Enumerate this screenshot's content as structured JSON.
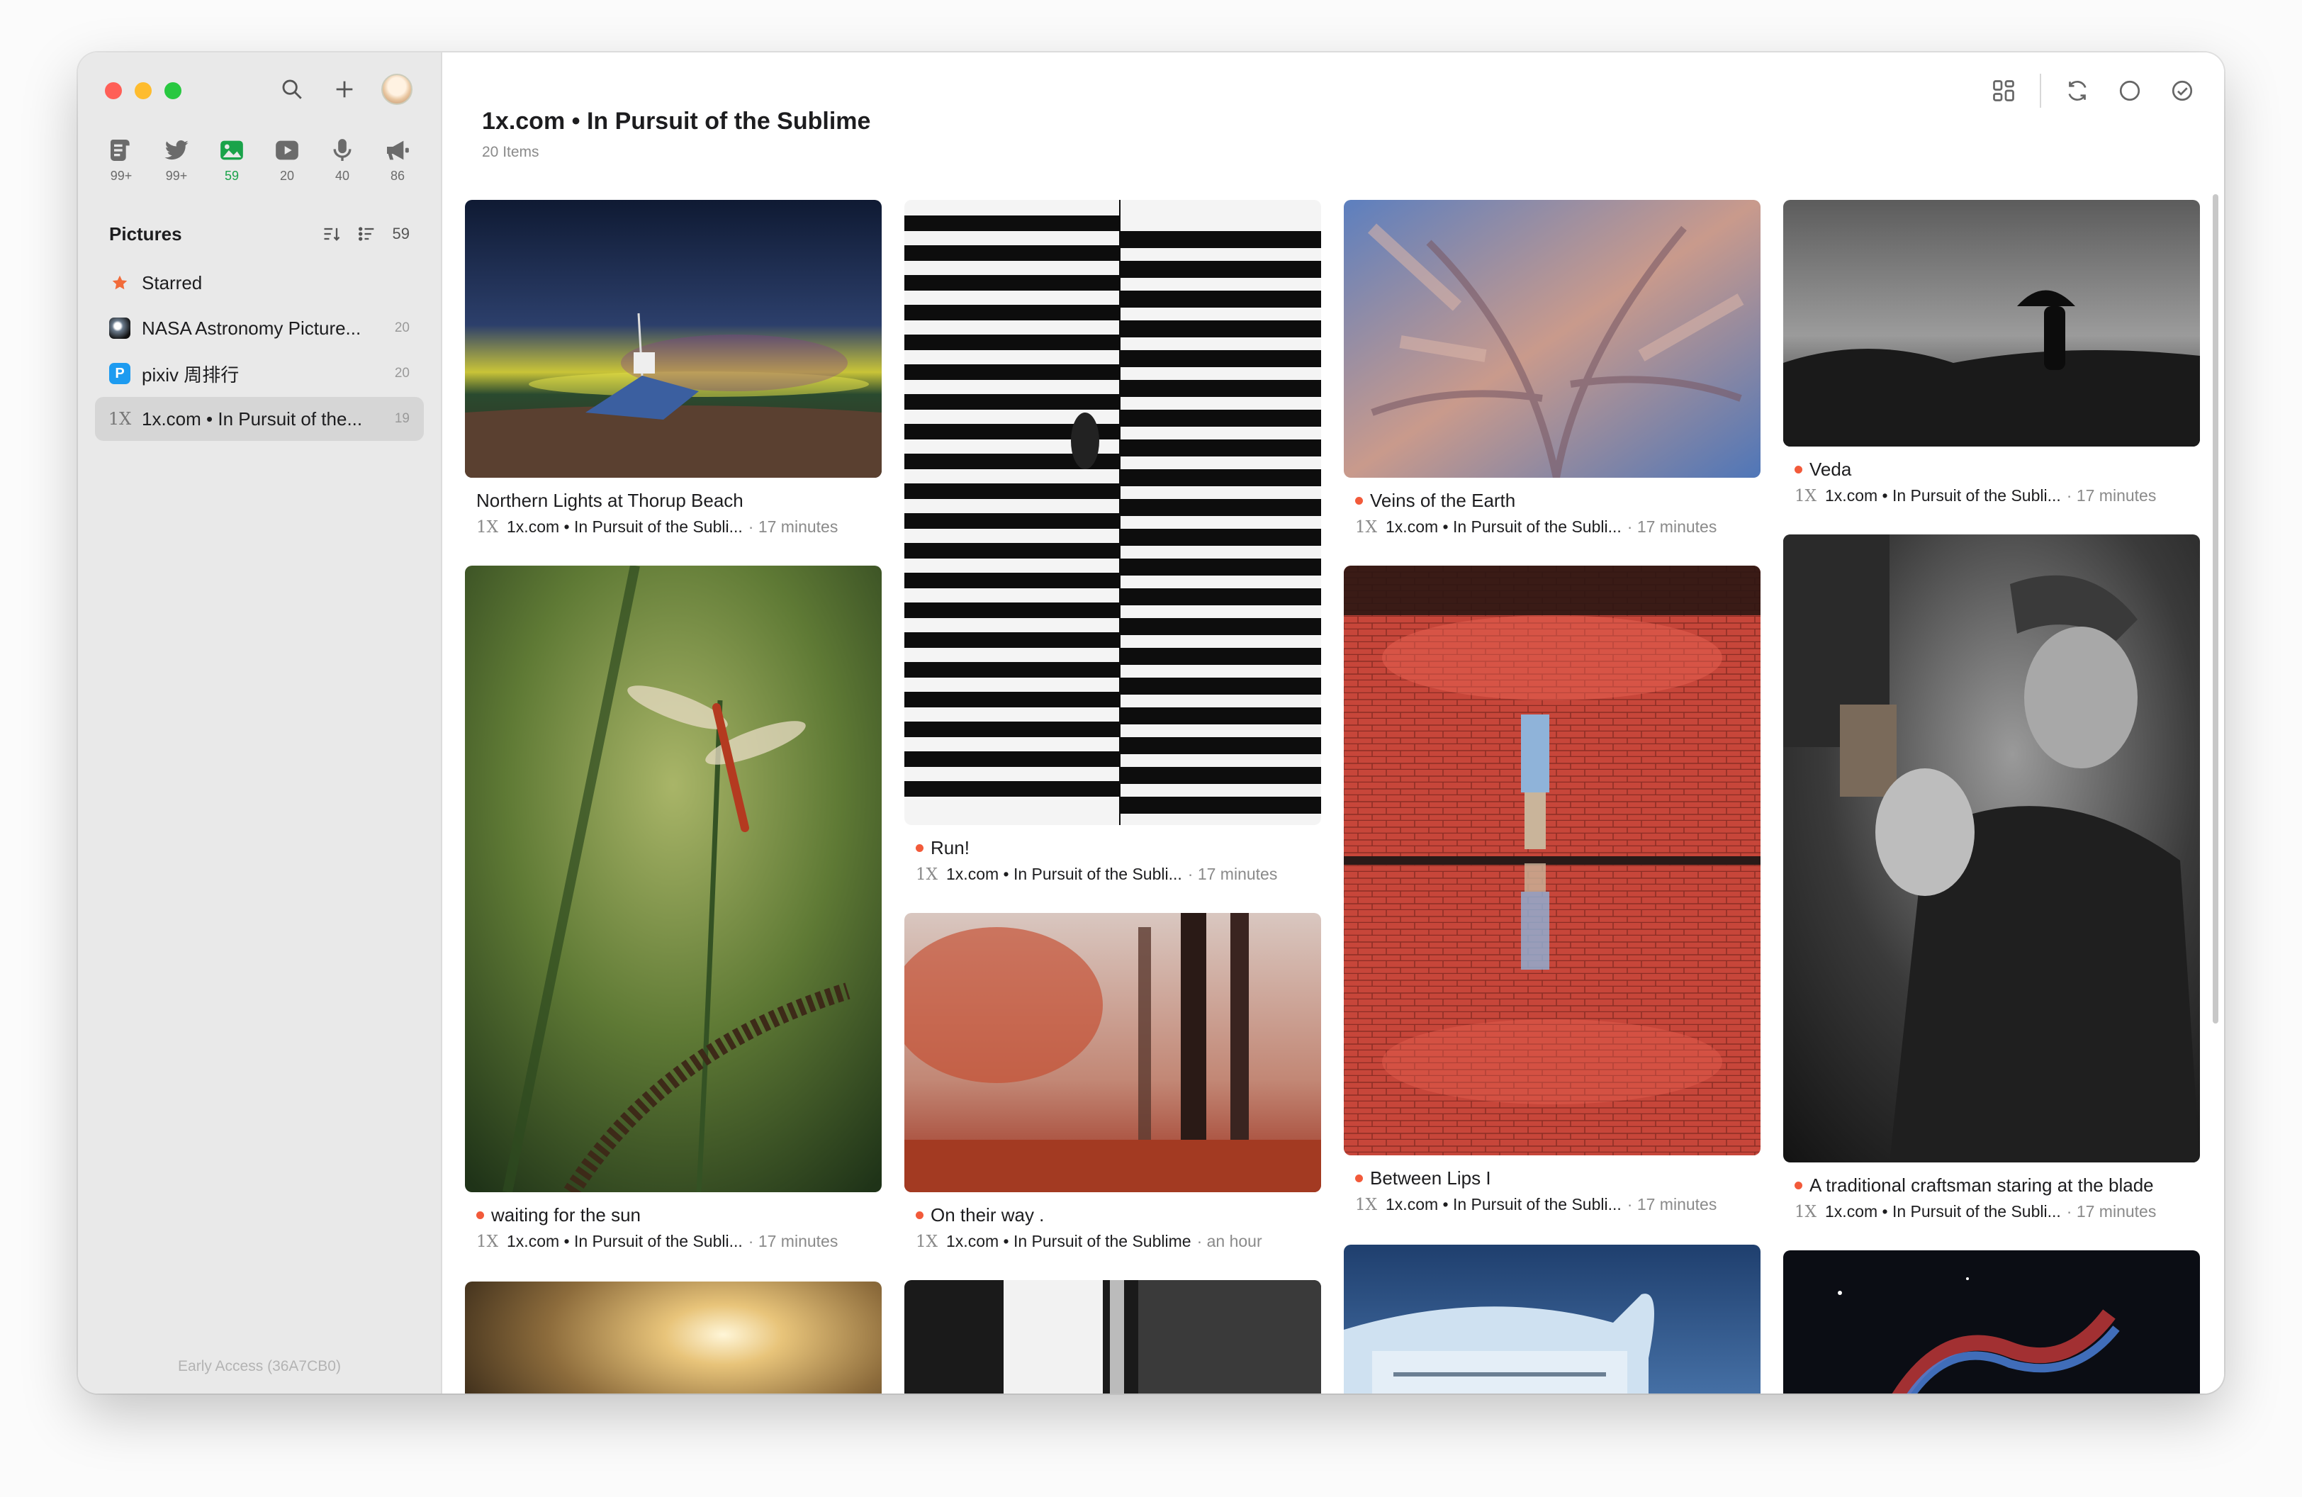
{
  "sidebar": {
    "type_tabs": [
      {
        "icon": "article-icon",
        "count": "99+"
      },
      {
        "icon": "twitter-icon",
        "count": "99+"
      },
      {
        "icon": "pictures-icon",
        "count": "59"
      },
      {
        "icon": "video-icon",
        "count": "20"
      },
      {
        "icon": "podcast-icon",
        "count": "40"
      },
      {
        "icon": "notification-icon",
        "count": "86"
      }
    ],
    "section_title": "Pictures",
    "section_count": "59",
    "feeds": [
      {
        "label": "Starred",
        "count": ""
      },
      {
        "label": "NASA Astronomy Picture...",
        "count": "20"
      },
      {
        "label": "pixiv 周排行",
        "count": "20"
      },
      {
        "label": "1x.com • In Pursuit of the...",
        "count": "19"
      }
    ],
    "footer": "Early Access (36A7CB0)"
  },
  "main": {
    "title": "1x.com • In Pursuit of the Sublime",
    "subtitle": "20 Items",
    "cards": [
      {
        "title": "Northern Lights at Thorup Beach",
        "source": "1x.com • In Pursuit of the Subli...",
        "time": "· 17 minutes",
        "unread": false
      },
      {
        "title": "waiting for the sun",
        "source": "1x.com • In Pursuit of the Subli...",
        "time": "· 17 minutes",
        "unread": true
      },
      {
        "title": "Run!",
        "source": "1x.com • In Pursuit of the Subli...",
        "time": "· 17 minutes",
        "unread": true
      },
      {
        "title": "On their way .",
        "source": "1x.com • In Pursuit of the Sublime",
        "time": "· an hour",
        "unread": true
      },
      {
        "title": "Veins of the Earth",
        "source": "1x.com • In Pursuit of the Subli...",
        "time": "· 17 minutes",
        "unread": true
      },
      {
        "title": "Between Lips I",
        "source": "1x.com • In Pursuit of the Subli...",
        "time": "· 17 minutes",
        "unread": true
      },
      {
        "title": "Veda",
        "source": "1x.com • In Pursuit of the Subli...",
        "time": "· 17 minutes",
        "unread": true
      },
      {
        "title": "A traditional craftsman staring at the blade",
        "source": "1x.com • In Pursuit of the Subli...",
        "time": "· 17 minutes",
        "unread": true
      }
    ],
    "source_mark": "1X"
  },
  "colors": {
    "accent_green": "#1aa34a",
    "unread_dot": "#f25a3a",
    "sidebar_bg": "#e9e9e9"
  }
}
